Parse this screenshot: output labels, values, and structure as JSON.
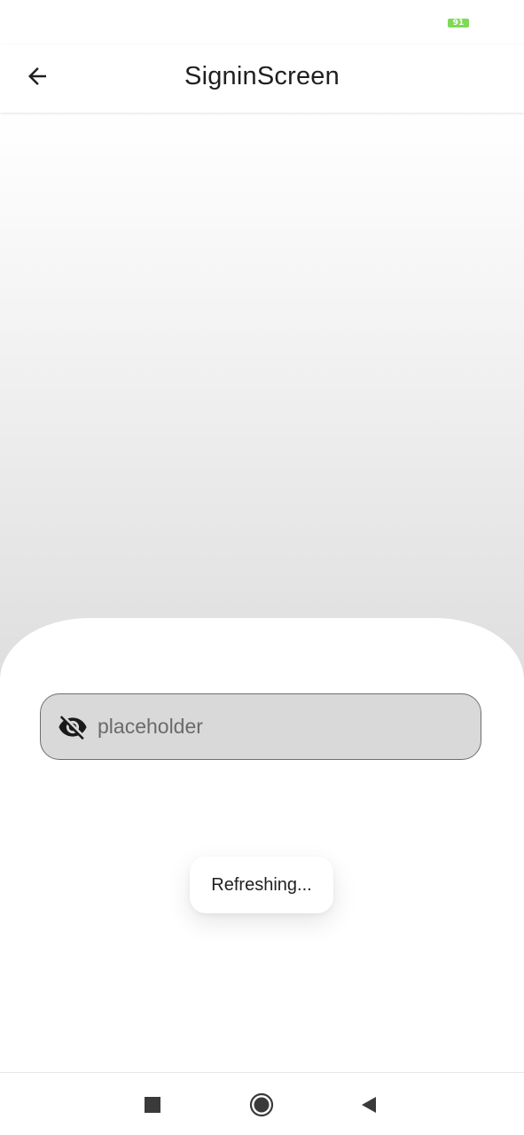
{
  "status_bar": {
    "battery_level": "91"
  },
  "app_bar": {
    "title": "SigninScreen",
    "back_icon": "arrow-left-icon"
  },
  "password_field": {
    "value": "",
    "placeholder": "placeholder",
    "toggle_icon": "eye-off-icon"
  },
  "toast": {
    "message": "Refreshing..."
  },
  "nav_bar": {
    "recents_icon": "square-icon",
    "home_icon": "circle-icon",
    "back_icon": "triangle-left-icon"
  },
  "colors": {
    "battery": "#7ed957",
    "field_background": "#d9d9d9",
    "field_border": "#6e6e6e",
    "title_text": "#1f1f1f"
  }
}
